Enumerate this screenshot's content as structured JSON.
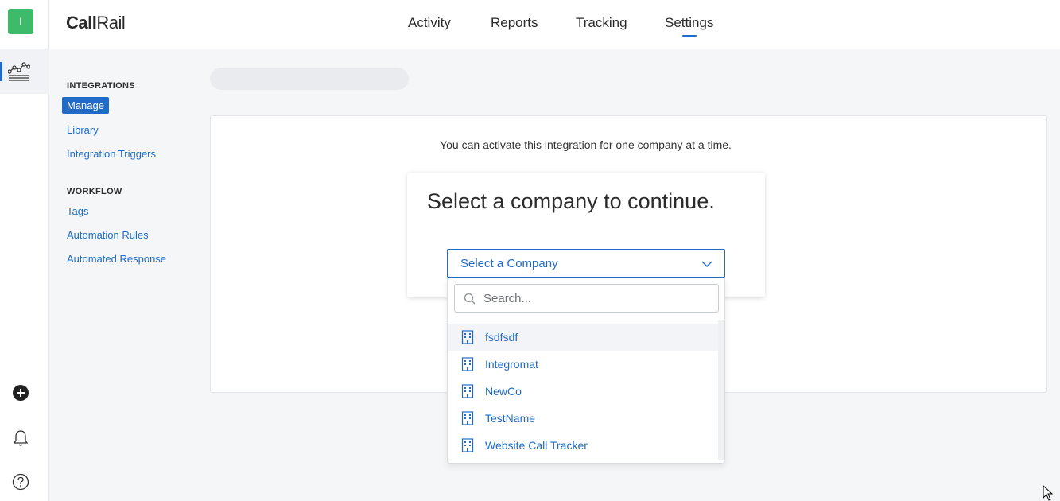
{
  "rail": {
    "avatar_letter": "I",
    "accent": "#3dbb6b"
  },
  "brand": {
    "logo_part1": "Call",
    "logo_part2": "Rail"
  },
  "nav": [
    {
      "label": "Activity"
    },
    {
      "label": "Reports"
    },
    {
      "label": "Tracking"
    },
    {
      "label": "Settings",
      "active": true
    }
  ],
  "sidebar": {
    "integrations_heading": "INTEGRATIONS",
    "integrations_items": [
      {
        "label": "Manage",
        "active": true
      },
      {
        "label": "Library"
      },
      {
        "label": "Integration Triggers"
      }
    ],
    "workflow_heading": "WORKFLOW",
    "workflow_items": [
      {
        "label": "Tags"
      },
      {
        "label": "Automation Rules"
      },
      {
        "label": "Automated Response"
      }
    ]
  },
  "main": {
    "message": "You can activate this integration for one company at a time.",
    "card_title": "Select a company to continue.",
    "select_label": "Select a Company",
    "search_placeholder": "Search...",
    "companies": [
      "fsdfsdf",
      "Integromat",
      "NewCo",
      "TestName",
      "Website Call Tracker"
    ]
  },
  "colors": {
    "primary": "#1f6bc7",
    "background": "#f5f6f8"
  }
}
